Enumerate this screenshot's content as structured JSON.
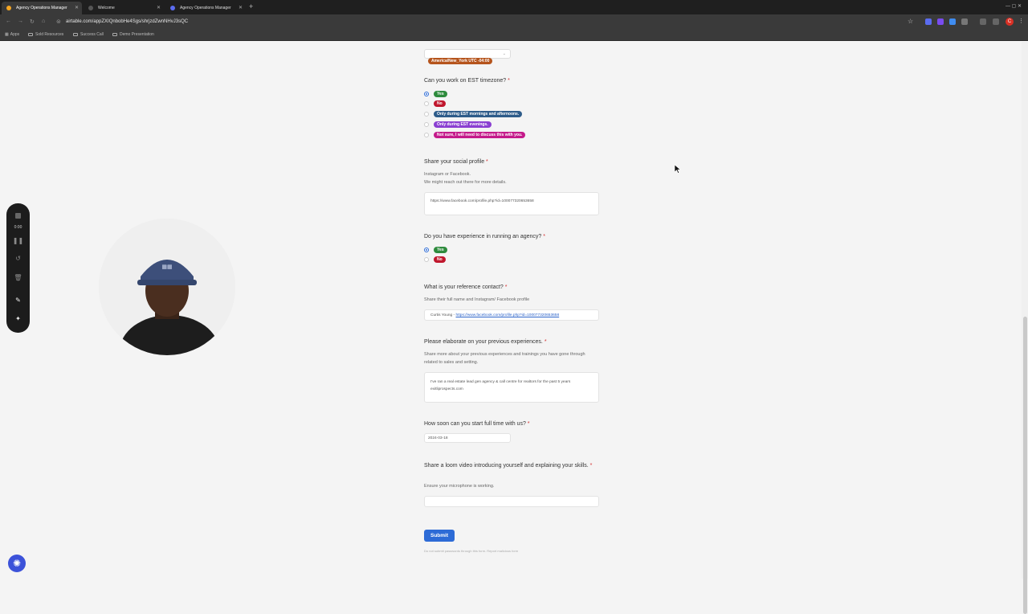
{
  "browser": {
    "tabs": [
      {
        "title": "Agency Operations Manager",
        "active": true
      },
      {
        "title": "Welcome",
        "active": false
      },
      {
        "title": "Agency Operations Manager",
        "active": false
      }
    ],
    "url": "airtable.com/appZXIQnbobHe4Sgs/shrjzdZwnNHvJ3sQC",
    "bookmarks": [
      "Apps",
      "Sold Resources",
      "Success Call",
      "Demo Presentation"
    ],
    "profile_initial": "C"
  },
  "form": {
    "timezone_value": "America/New_York UTC -04:00",
    "est_question": "Can you work on EST timezone?",
    "est_options": [
      {
        "label": "Yes",
        "color": "#2e8b3d",
        "selected": true
      },
      {
        "label": "No",
        "color": "#c0172d",
        "selected": false
      },
      {
        "label": "Only during EST mornings and afternoons.",
        "color": "#2e5c8a",
        "selected": false
      },
      {
        "label": "Only during EST evenings.",
        "color": "#8a3fd1",
        "selected": false
      },
      {
        "label": "Not sure, I will need to discuss this with you.",
        "color": "#c41a8a",
        "selected": false
      }
    ],
    "social_question": "Share your social profile",
    "social_help_1": "Instagram or Facebook.",
    "social_help_2": "We might reach out there for more details.",
    "social_value": "https://www.facebook.com/profile.php?id=100077320653658",
    "agency_question": "Do you have experience in running an agency?",
    "agency_options": [
      {
        "label": "Yes",
        "color": "#2e8b3d",
        "selected": true
      },
      {
        "label": "No",
        "color": "#c0172d",
        "selected": false
      }
    ],
    "reference_question": "What is your reference contact?",
    "reference_help": "Share their full name and Instagram/ Facebook profile",
    "reference_name": "Curtis Young - ",
    "reference_link": "https://www.facebook.com/profile.php?id=100077320653658",
    "experience_question": "Please elaborate on your previous experiences.",
    "experience_help": "Share more about your previous experiences and trainings you have gone through related to sales and setting.",
    "experience_value": "I've ran a real estate lead gen agency & call centre for realtors for the past 5 years exitliprospects.com",
    "start_question": "How soon can you start full time with us?",
    "start_value": "2024-03-18",
    "loom_question": "Share a loom video introducing yourself and explaining your skills.",
    "loom_help": "Ensure your microphone is working.",
    "loom_value": "",
    "submit_label": "Submit",
    "footer_note": "Do not submit passwords through this form. Report malicious form"
  },
  "recorder": {
    "time": "0:00"
  },
  "accent_color": "#2d6bd6"
}
